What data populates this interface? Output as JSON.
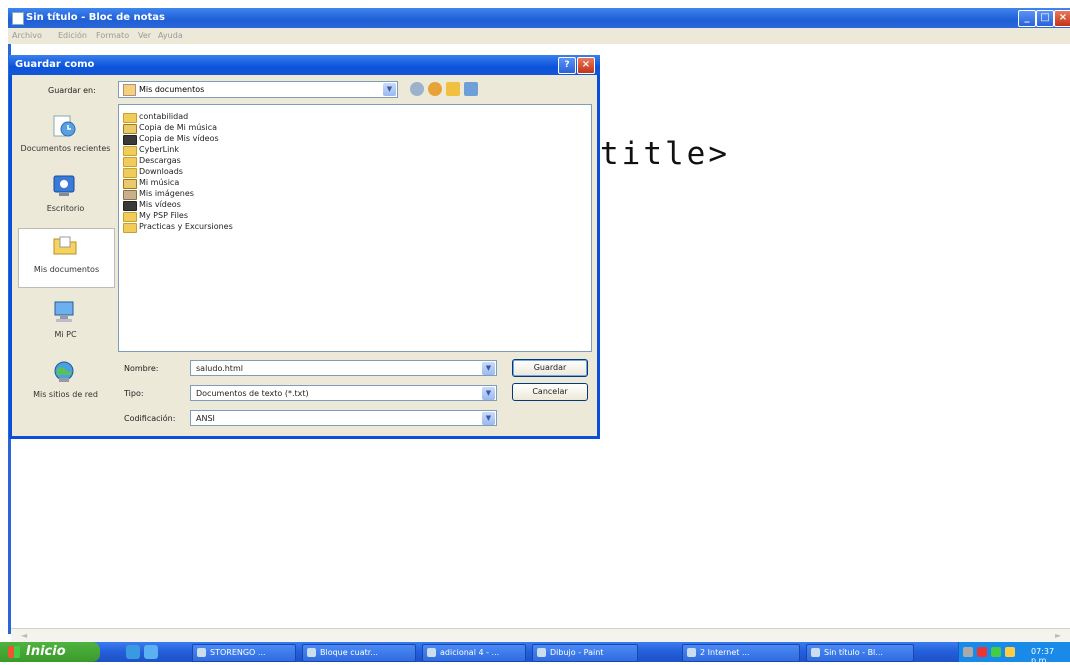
{
  "notepad": {
    "title": "Sin título - Bloc de notas",
    "menu": [
      "Archivo",
      "Edición",
      "Formato",
      "Ver",
      "Ayuda"
    ],
    "content": "title>"
  },
  "dialog": {
    "title": "Guardar como",
    "look_in_label": "Guardar en:",
    "look_in_value": "Mis documentos",
    "places": [
      {
        "label": "Documentos recientes",
        "icon": "recent-documents-icon"
      },
      {
        "label": "Escritorio",
        "icon": "desktop-icon"
      },
      {
        "label": "Mis documentos",
        "icon": "my-documents-icon"
      },
      {
        "label": "Mi PC",
        "icon": "my-computer-icon"
      },
      {
        "label": "Mis sitios de red",
        "icon": "network-places-icon"
      }
    ],
    "files": [
      "contabilidad",
      "Copia de Mi música",
      "Copia de Mis vídeos",
      "CyberLink",
      "Descargas",
      "Downloads",
      "Mi música",
      "Mis imágenes",
      "Mis vídeos",
      "My PSP Files",
      "Practicas y Excursiones"
    ],
    "filename_label": "Nombre:",
    "filename_value": "saludo.html",
    "type_label": "Tipo:",
    "type_value": "Documentos de texto (*.txt)",
    "encoding_label": "Codificación:",
    "encoding_value": "ANSI",
    "save_button": "Guardar",
    "cancel_button": "Cancelar"
  },
  "taskbar": {
    "start_label": "Inicio",
    "tasks": [
      "STORENGO ...",
      "Bloque cuatr...",
      "adicional 4 - ...",
      "Dibujo - Paint",
      "2 Internet ...",
      "Sin título - Bl..."
    ],
    "clock": "07:37 p.m."
  }
}
